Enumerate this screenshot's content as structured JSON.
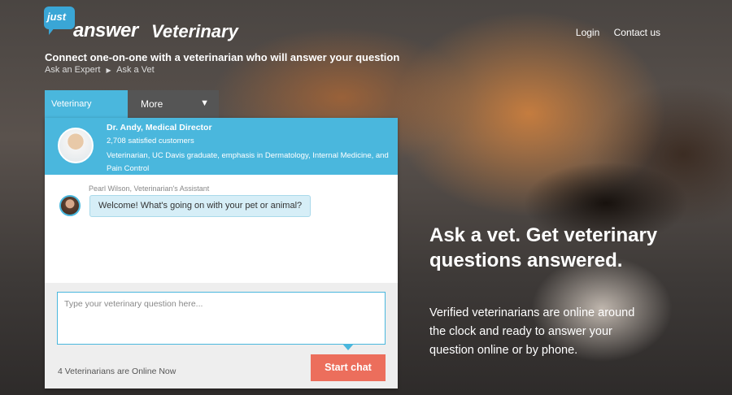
{
  "logo": {
    "just": "just",
    "answer": "answer",
    "product": "Veterinary"
  },
  "topnav": {
    "login": "Login",
    "contact": "Contact us"
  },
  "tagline": "Connect one-on-one with a veterinarian who will answer your question",
  "breadcrumb": {
    "items": [
      "Ask an Expert",
      "Ask a Vet"
    ],
    "separator_icon": "caret-right-icon"
  },
  "tabs": {
    "active": "Veterinary",
    "more": "More",
    "more_icon": "triangle-down-icon"
  },
  "expert": {
    "name": "Dr. Andy, Medical Director",
    "customers": "2,708 satisfied customers",
    "description": "Veterinarian, UC Davis graduate, emphasis in Dermatology, Internal Medicine, and Pain Control"
  },
  "assistant": {
    "label": "Pearl Wilson, Veterinarian's Assistant",
    "message": "Welcome! What's going on with your pet or animal?"
  },
  "compose": {
    "placeholder": "Type your veterinary question here...",
    "online_status": "4 Veterinarians are Online Now",
    "start_button": "Start chat"
  },
  "hero": {
    "title": "Ask a vet. Get veterinary questions answered.",
    "body": "Verified veterinarians are online around the clock and ready to answer your question online or by phone."
  },
  "colors": {
    "accent": "#4ab7dd",
    "button": "#ec6e5c",
    "tab_inactive": "#555555"
  }
}
